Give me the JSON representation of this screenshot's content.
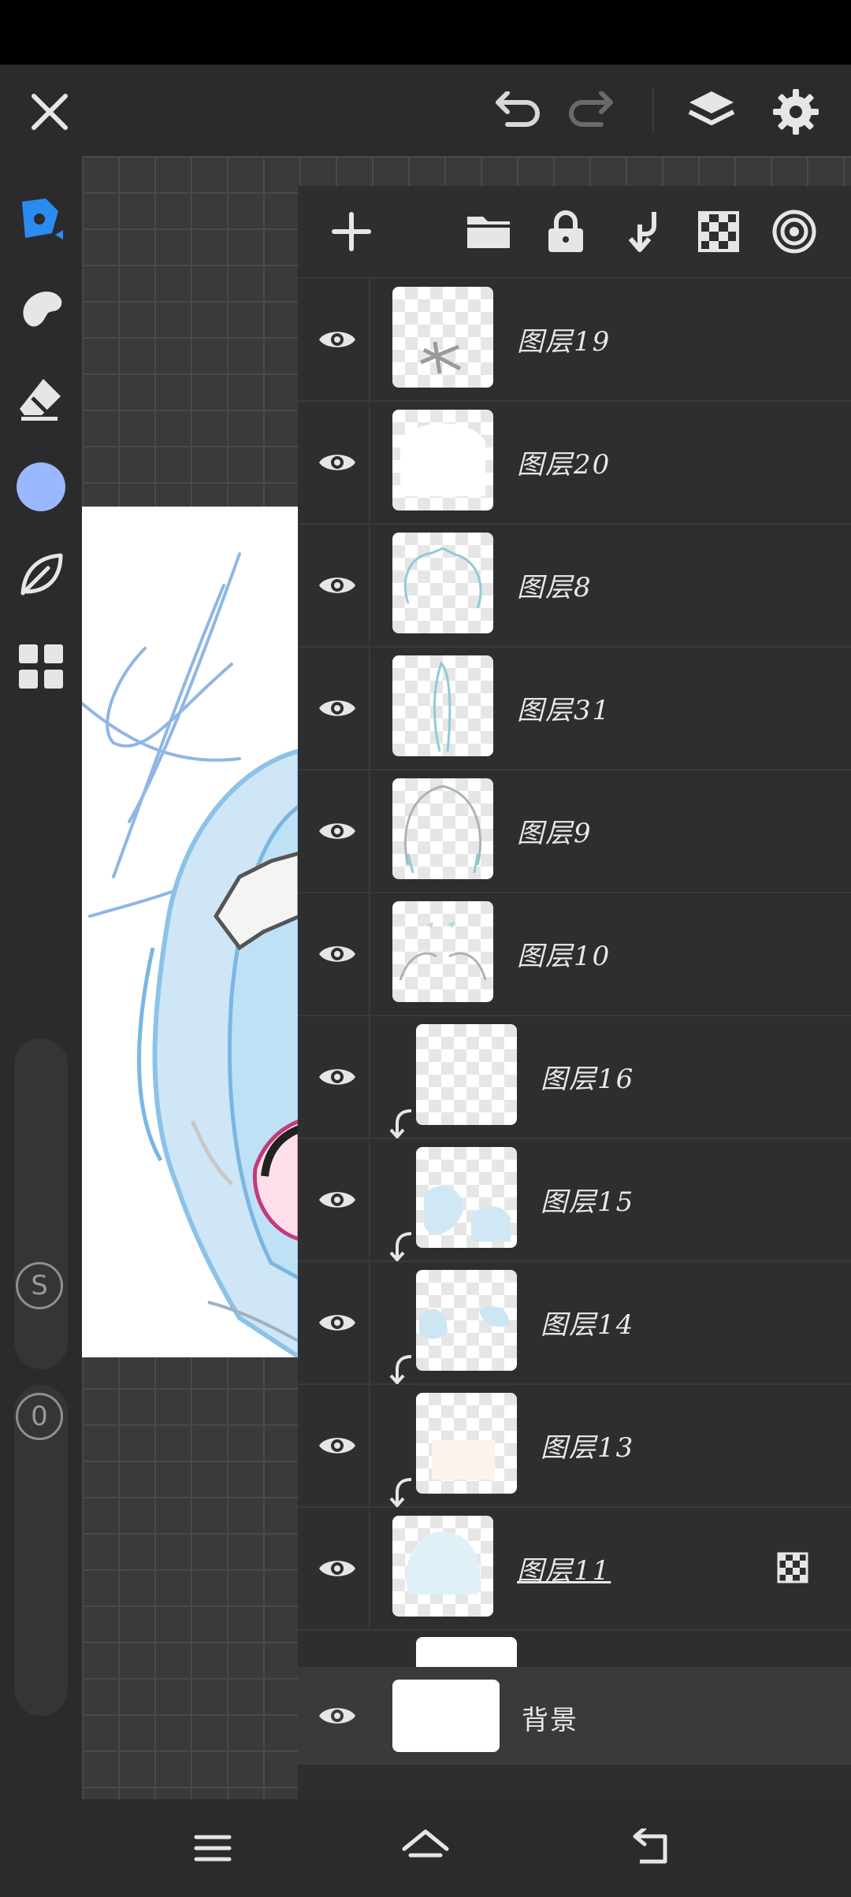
{
  "app": {
    "accent": "#2a8cf0",
    "color_swatch": "#9ab8ff"
  },
  "toolbar": {
    "close_icon": "close-icon",
    "undo_icon": "undo-icon",
    "redo_icon": "redo-icon",
    "layers_icon": "layers-icon",
    "settings_icon": "gear-icon"
  },
  "left_tools": {
    "items": [
      "pen-icon",
      "smudge-icon",
      "eraser-icon",
      "color-swatch",
      "leaf-icon",
      "grid-icon"
    ],
    "size_label": "S",
    "opacity_label": "0"
  },
  "layers_panel": {
    "actions": [
      "add-icon",
      "folder-icon",
      "lock-icon",
      "clip-icon",
      "transparency-icon",
      "target-icon"
    ],
    "layers": [
      {
        "name": "图层19",
        "clipped": false
      },
      {
        "name": "图层20",
        "clipped": false
      },
      {
        "name": "图层8",
        "clipped": false
      },
      {
        "name": "图层31",
        "clipped": false
      },
      {
        "name": "图层9",
        "clipped": false
      },
      {
        "name": "图层10",
        "clipped": false
      },
      {
        "name": "图层16",
        "clipped": true
      },
      {
        "name": "图层15",
        "clipped": true
      },
      {
        "name": "图层14",
        "clipped": true
      },
      {
        "name": "图层13",
        "clipped": true
      },
      {
        "name": "图层11",
        "clipped": false,
        "selected": true
      }
    ],
    "background_layer": "背景"
  },
  "navbar": {
    "menu_icon": "menu-icon",
    "home_icon": "home-icon",
    "back_icon": "back-icon"
  }
}
